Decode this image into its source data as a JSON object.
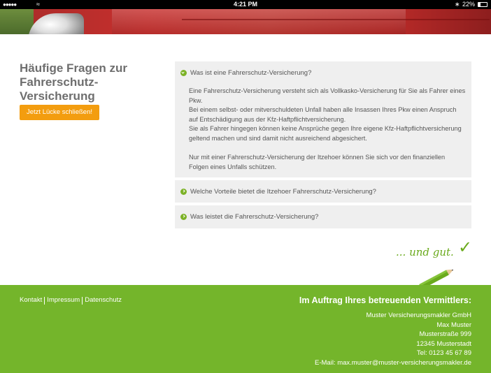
{
  "status_bar": {
    "signal": "●●●●●",
    "time": "4:21 PM",
    "battery": "22%",
    "wifi_icon": "wifi-icon",
    "bluetooth_icon": "bluetooth-icon"
  },
  "left": {
    "title": "Häufige Fragen zur Fahrerschutz-Versicherung",
    "cta_label": "Jetzt Lücke schließen!"
  },
  "faq": {
    "items": [
      {
        "question": "Was ist eine Fahrerschutz-Versicherung?",
        "expanded": true,
        "answer_p1": "Eine Fahrerschutz-Versicherung versteht sich als Vollkasko-Versicherung für Sie als Fahrer eines Pkw.",
        "answer_p2": "Bei einem selbst- oder mitverschuldeten Unfall haben alle Insassen Ihres Pkw einen Anspruch auf Entschädigung aus der Kfz-Haftpflichtversicherung.",
        "answer_p3": "Sie als Fahrer hingegen können keine Ansprüche gegen Ihre eigene Kfz-Haftpflichtversicherung geltend machen und sind damit nicht ausreichend abgesichert.",
        "answer_p4": "Nur mit einer Fahrerschutz-Versicherung der Itzehoer können Sie sich vor den finanziellen Folgen eines Unfalls schützen."
      },
      {
        "question": "Welche Vorteile bietet die Itzehoer Fahrerschutz-Versicherung?",
        "expanded": false
      },
      {
        "question": "Was leistet die Fahrerschutz-Versicherung?",
        "expanded": false
      }
    ]
  },
  "tagline": "... und gut.",
  "footer": {
    "links": [
      "Kontakt",
      "Impressum",
      "Datenschutz"
    ],
    "agent_heading": "Im Auftrag Ihres betreuenden Vermittlers:",
    "company": "Muster Versicherungsmakler GmbH",
    "name": "Max Muster",
    "street": "Musterstraße 999",
    "city": "12345 Musterstadt",
    "phone": "Tel: 0123 45 67 89",
    "email": "E-Mail: max.muster@muster-versicherungsmakler.de"
  },
  "colors": {
    "accent_green": "#74b52b",
    "cta_orange": "#f39d0f"
  }
}
